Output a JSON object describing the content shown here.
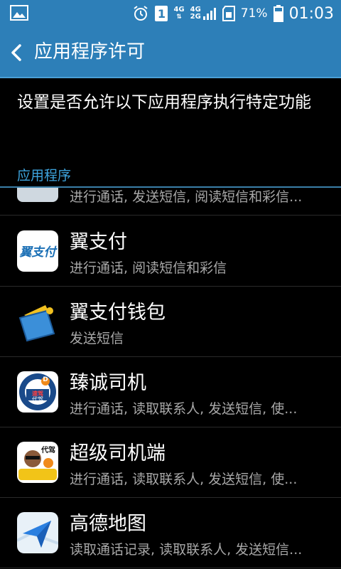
{
  "status_bar": {
    "sim_label": "1",
    "net1_top": "4G",
    "net2_top": "4G",
    "net2_bottom": "2G",
    "battery_percent": "71%",
    "time": "01:03"
  },
  "app_bar": {
    "title": "应用程序许可"
  },
  "description": "设置是否允许以下应用程序执行特定功能",
  "section_header": "应用程序",
  "partial_item": {
    "subtitle": "进行通话, 发送短信, 阅读短信和彩信..."
  },
  "apps": [
    {
      "name": "翼支付",
      "permissions": "进行通话, 阅读短信和彩信",
      "icon": "yizhifu-icon"
    },
    {
      "name": "翼支付钱包",
      "permissions": "发送短信",
      "icon": "wallet-icon"
    },
    {
      "name": "臻诚司机",
      "permissions": "进行通话, 读取联系人, 发送短信, 使...",
      "icon": "steering-wheel-icon"
    },
    {
      "name": "超级司机端",
      "permissions": "进行通话, 读取联系人, 发送短信, 使...",
      "icon": "super-driver-icon"
    },
    {
      "name": "高德地图",
      "permissions": "读取通话记录, 读取联系人, 发送短信...",
      "icon": "amap-icon"
    }
  ],
  "icon_text": {
    "yizhifu": "翼支付",
    "wheel_badge": "D",
    "wheel_line1": "速驾",
    "wheel_line2": "代驾",
    "driver_top": "代驾"
  }
}
